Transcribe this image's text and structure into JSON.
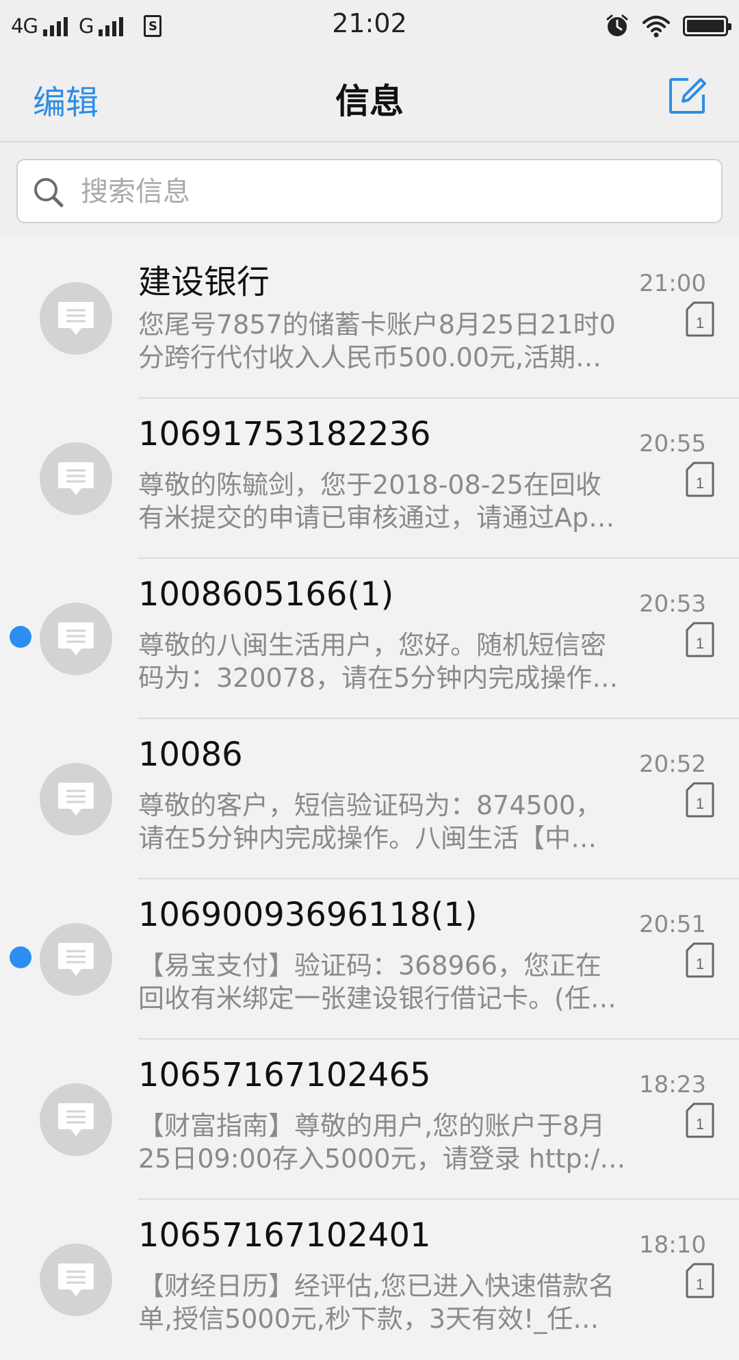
{
  "status_bar": {
    "network_1": "4G",
    "network_2": "G",
    "time": "21:02",
    "icons": [
      "signal-icon",
      "sim-icon",
      "alarm-icon",
      "wifi-icon",
      "battery-icon"
    ]
  },
  "nav": {
    "edit_label": "编辑",
    "title": "信息",
    "compose_icon": "compose-icon",
    "accent_color": "#2e8de6"
  },
  "search": {
    "placeholder": "搜索信息",
    "value": ""
  },
  "messages": [
    {
      "sender": "建设银行",
      "time": "21:00",
      "sim": "1",
      "unread": false,
      "preview_line1": "您尾号7857的储蓄卡账户8月25日21时0",
      "preview_line2": "分跨行代付收入人民币500.00元,活期…"
    },
    {
      "sender": "10691753182236",
      "time": "20:55",
      "sim": "1",
      "unread": false,
      "preview_line1": "尊敬的陈毓剑，您于2018-08-25在回收",
      "preview_line2": "有米提交的申请已审核通过，请通过Ap…"
    },
    {
      "sender": "1008605166(1)",
      "time": "20:53",
      "sim": "1",
      "unread": true,
      "preview_line1": "尊敬的八闽生活用户，您好。随机短信密",
      "preview_line2": "码为：320078，请在5分钟内完成操作…"
    },
    {
      "sender": "10086",
      "time": "20:52",
      "sim": "1",
      "unread": false,
      "preview_line1": "尊敬的客户，短信验证码为：874500，",
      "preview_line2": "请在5分钟内完成操作。八闽生活【中…"
    },
    {
      "sender": "10690093696118(1)",
      "time": "20:51",
      "sim": "1",
      "unread": true,
      "preview_line1": "【易宝支付】验证码：368966，您正在",
      "preview_line2": "回收有米绑定一张建设银行借记卡。(任…"
    },
    {
      "sender": "10657167102465",
      "time": "18:23",
      "sim": "1",
      "unread": false,
      "preview_line1": "【财富指南】尊敬的用户,您的账户于8月",
      "preview_line2": "25日09:00存入5000元，请登录 http:/…"
    },
    {
      "sender": "10657167102401",
      "time": "18:10",
      "sim": "1",
      "unread": false,
      "preview_line1": "【财经日历】经评估,您已进入快速借款名",
      "preview_line2": "单,授信5000元,秒下款，3天有效!_任…"
    }
  ]
}
